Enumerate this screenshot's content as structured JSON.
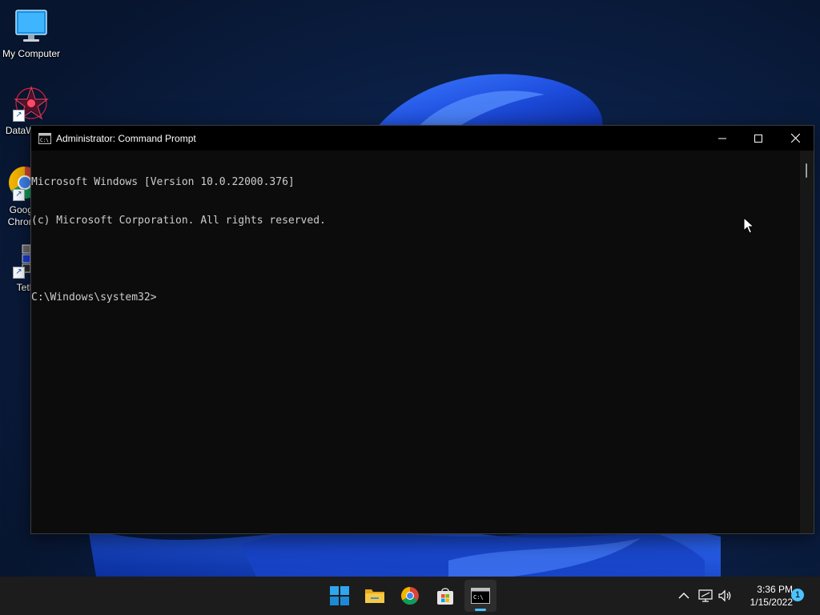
{
  "desktop": {
    "icons": [
      {
        "label": "My Computer",
        "icon": "monitor-icon"
      },
      {
        "label": "DataWarrior",
        "icon": "datawarrior-icon"
      },
      {
        "label": "Google Chrome",
        "icon": "chrome-icon"
      },
      {
        "label": "TetFun",
        "icon": "tetfun-icon"
      }
    ]
  },
  "window": {
    "title": "Administrator: Command Prompt",
    "icon": "cmd-icon",
    "controls": {
      "minimize": "minimize-icon",
      "maximize": "maximize-icon",
      "close": "close-icon"
    },
    "console_lines": [
      "Microsoft Windows [Version 10.0.22000.376]",
      "(c) Microsoft Corporation. All rights reserved.",
      "",
      "C:\\Windows\\system32>"
    ]
  },
  "taskbar": {
    "apps": [
      {
        "name": "start",
        "icon": "windows-start-icon",
        "active": false
      },
      {
        "name": "file-explorer",
        "icon": "folder-icon",
        "active": false
      },
      {
        "name": "chrome",
        "icon": "chrome-icon",
        "active": false
      },
      {
        "name": "microsoft-store",
        "icon": "store-icon",
        "active": false
      },
      {
        "name": "command-prompt",
        "icon": "cmd-icon",
        "active": true
      }
    ],
    "tray": {
      "icons": [
        "chevron-up-icon",
        "network-icon",
        "volume-icon"
      ],
      "time": "3:36 PM",
      "date": "1/15/2022",
      "notification_count": "1"
    }
  },
  "colors": {
    "accent": "#4cc2ff",
    "console_bg": "#0c0c0c",
    "console_text": "#cccccc",
    "taskbar_bg": "#1c1c1c"
  }
}
